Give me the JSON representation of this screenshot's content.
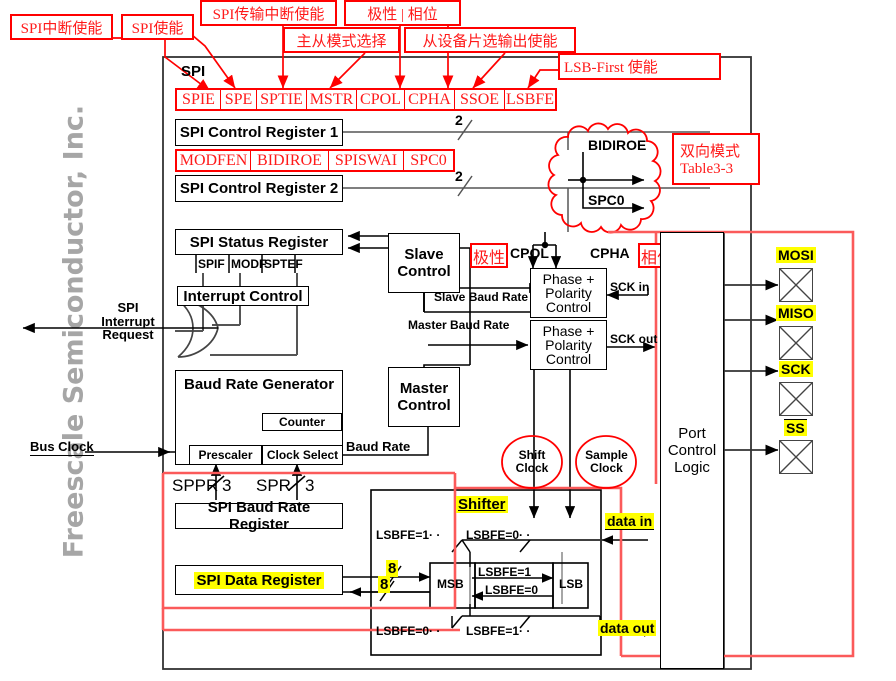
{
  "watermark": "Freescale Semiconductor, Inc.",
  "module": {
    "title": "SPI"
  },
  "callouts": {
    "spi_int_enable": "SPI中断使能",
    "spi_enable": "SPI使能",
    "spi_tx_int_enable": "SPI传输中断使能",
    "polarity_phase": "极性  |  相位",
    "master_slave_select": "主从模式选择",
    "slave_select_out_enable": "从设备片选输出使能",
    "lsb_first_enable": "LSB-First 使能",
    "bidir_mode": "双向模式",
    "bidir_table": "Table3-3",
    "polarity": "极性",
    "phase": "相位"
  },
  "registers": {
    "scr1_bits": [
      "SPIE",
      "SPE",
      "SPTIE",
      "MSTR",
      "CPOL",
      "CPHA",
      "SSOE",
      "LSBFE"
    ],
    "scr1_name": "SPI Control Register 1",
    "scr2_bits": [
      "MODFEN",
      "BIDIROE",
      "SPISWAI",
      "SPC0"
    ],
    "scr2_name": "SPI Control Register 2",
    "status_name": "SPI Status Register",
    "status_bits": [
      "SPIF",
      "MODF",
      "SPTEF"
    ],
    "baud_name": "SPI Baud Rate Register",
    "data_name": "SPI Data Register"
  },
  "blocks": {
    "interrupt_control": "Interrupt Control",
    "slave_control": "Slave\nControl",
    "slave_control_l1": "Slave",
    "slave_control_l2": "Control",
    "master_control_l1": "Master",
    "master_control_l2": "Control",
    "baud_rate_generator": "Baud Rate Generator",
    "counter": "Counter",
    "prescaler": "Prescaler",
    "clock_select": "Clock Select",
    "phase_polarity_1": "Phase +\nPolarity\nControl",
    "phase_polarity_2": "Phase +\nPolarity\nControl",
    "pp_l1": "Phase +",
    "pp_l2": "Polarity",
    "pp_l3": "Control",
    "port_control_l1": "Port",
    "port_control_l2": "Control",
    "port_control_l3": "Logic",
    "shift_clock_l1": "Shift",
    "shift_clock_l2": "Clock",
    "sample_clock_l1": "Sample",
    "sample_clock_l2": "Clock",
    "bidiroe": "BIDIROE",
    "spc0": "SPC0",
    "shifter": "Shifter",
    "msb": "MSB",
    "lsb": "LSB"
  },
  "signals": {
    "spi_interrupt_request_l1": "SPI",
    "spi_interrupt_request_l2": "Interrupt",
    "spi_interrupt_request_l3": "Request",
    "bus_clock": "Bus Clock",
    "slave_baud_rate": "Slave Baud Rate",
    "master_baud_rate": "Master Baud Rate",
    "baud_rate": "Baud Rate",
    "sck_in": "SCK in",
    "sck_out": "SCK out",
    "cpol": "CPOL",
    "cpha": "CPHA",
    "sppr": "SPPR",
    "spr": "SPR",
    "sppr_width": "3",
    "spr_width": "3",
    "bus_width_in": "8",
    "bus_width_out": "8",
    "width_2a": "2",
    "width_2b": "2",
    "data_in": "data in",
    "data_out": "data out"
  },
  "shifter_conditions": {
    "top_left": "LSBFE=1",
    "top_right": "LSBFE=0",
    "mid_right_arrow": "LSBFE=1",
    "mid_left_arrow": "LSBFE=0",
    "bottom_left": "LSBFE=0",
    "bottom_right": "LSBFE=1"
  },
  "pins": [
    {
      "label": "MOSI",
      "overline": false
    },
    {
      "label": "MISO",
      "overline": false
    },
    {
      "label": "SCK",
      "overline": false
    },
    {
      "label": "SS",
      "overline": true
    }
  ],
  "colors": {
    "annotation_red": "#ff1a1a",
    "highlight_red": "#fb5a5a",
    "highlight_yellow": "#ffff00",
    "line_black": "#000000",
    "watermark_gray": "#a6a6a6"
  }
}
